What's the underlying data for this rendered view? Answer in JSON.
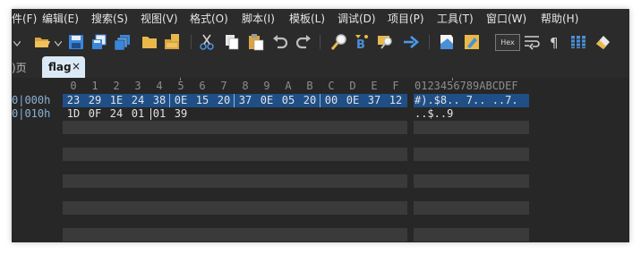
{
  "menubar": {
    "items": [
      "件(F)",
      "编辑(E)",
      "搜索(S)",
      "视图(V)",
      "格式(O)",
      "脚本(I)",
      "模板(L)",
      "调试(D)",
      "项目(P)",
      "工具(T)",
      "窗口(W)",
      "帮助(H)"
    ]
  },
  "toolbar": {
    "icons": [
      "new-file-icon",
      "open-folder-icon",
      "save-icon",
      "save-as-icon",
      "save-all-icon",
      "folder-icon",
      "open-workspace-icon",
      "cut-icon",
      "copy-icon",
      "paste-icon",
      "undo-icon",
      "redo-icon",
      "find-icon",
      "replace-icon",
      "find-in-files-icon",
      "goto-icon",
      "bookmark-icon",
      "highlight-icon",
      "hex-mode-toggle",
      "wrap-icon",
      "show-whitespace-icon",
      "columns-icon",
      "clear-icon"
    ],
    "hex_label": "Hex",
    "colors": {
      "icon_blue": "#2f80d6",
      "icon_yellow": "#e8b84a",
      "icon_gray": "#cfcfcf"
    }
  },
  "tabs": {
    "previous_label": ")页",
    "active_label": "flag",
    "close_glyph": "×"
  },
  "editor": {
    "column_headers": [
      "0",
      "1",
      "2",
      "3",
      "4",
      "5",
      "6",
      "7",
      "8",
      "9",
      "A",
      "B",
      "C",
      "D",
      "E",
      "F"
    ],
    "ascii_header": "0123456789ABCDEF",
    "rows": [
      {
        "address": "0|000h",
        "bytes": [
          "23",
          "29",
          "1E",
          "24",
          "38",
          "0E",
          "15",
          "20",
          "37",
          "0E",
          "05",
          "20",
          "00",
          "0E",
          "37",
          "12"
        ],
        "ascii": "#).$8.. 7.. ..7.",
        "selected": true
      },
      {
        "address": "0|010h",
        "bytes": [
          "1D",
          "0F",
          "24",
          "01",
          "01",
          "39"
        ],
        "ascii": "..$..9",
        "selected": false
      }
    ],
    "colors": {
      "background": "#272727",
      "selection": "#1f4f86",
      "address_text": "#8ab0d6",
      "empty_band": "#3a3a3a"
    }
  }
}
